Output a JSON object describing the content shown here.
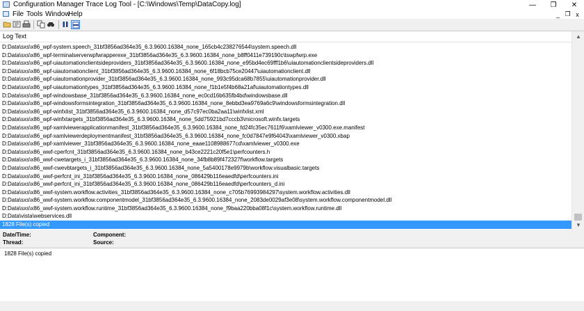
{
  "window": {
    "title": "Configuration Manager Trace Log Tool - [C:\\Windows\\Temp\\DataCopy.log]",
    "minimize_glyph": "—",
    "maximize_glyph": "❐",
    "close_glyph": "✕"
  },
  "menu": {
    "items": [
      "File",
      "Tools",
      "Window",
      "Help"
    ],
    "mdi_minimize": "_",
    "mdi_restore": "❐",
    "mdi_close": "x"
  },
  "toolbar": {
    "icons": [
      "open-icon",
      "refresh-icon",
      "print-icon",
      "copy-icon",
      "find-icon",
      "pause-icon",
      "highlight-icon"
    ]
  },
  "log": {
    "column_header": "Log Text",
    "selected_index": 22,
    "rows": [
      "D:Data\\sxs\\x86_wpf-system.speech_31bf3856ad364e35_6.3.9600.16384_none_165cb4c238276544\\system.speech.dll",
      "D:Data\\sxs\\x86_wpf-terminalserverwpfwrapperexe_31bf3856ad364e35_6.3.9600.16384_none_b8ff0411e739190c\\tswpfwrp.exe",
      "D:Data\\sxs\\x86_wpf-uiautomationclientsideproviders_31bf3856ad364e35_6.3.9600.16384_none_e95bd4ec69fff1b6\\uiautomationclientsideproviders.dll",
      "D:Data\\sxs\\x86_wpf-uiautomationclient_31bf3856ad364e35_6.3.9600.16384_none_6f18bcb75ce20447\\uiautomationclient.dll",
      "D:Data\\sxs\\x86_wpf-uiautomationprovider_31bf3856ad364e35_6.3.9600.16384_none_993c95dca68b7855\\uiautomationprovider.dll",
      "D:Data\\sxs\\x86_wpf-uiautomationtypes_31bf3856ad364e35_6.3.9600.16384_none_f1b1e5f4b68a21af\\uiautomationtypes.dll",
      "D:Data\\sxs\\x86_wpf-windowsbase_31bf3856ad364e35_6.3.9600.16384_none_ec0cd16b635fb4bd\\windowsbase.dll",
      "D:Data\\sxs\\x86_wpf-windowsformsintegration_31bf3856ad364e35_6.3.9600.16384_none_8ebbd3ea9769a6c9\\windowsformsintegration.dll",
      "D:Data\\sxs\\x86_wpf-winfxlist_31bf3856ad364e35_6.3.9600.16384_none_d57c97ec0ba2aa11\\winfxlist.xml",
      "D:Data\\sxs\\x86_wpf-winfxtargets_31bf3856ad364e35_6.3.9600.16384_none_5dd75921bd7cccb3\\microsoft.winfx.targets",
      "D:Data\\sxs\\x86_wpf-xamlviewerapplicationmanifest_31bf3856ad364e35_6.3.9600.16384_none_fd24fc35ec7611f6\\xamlviewer_v0300.exe.manifest",
      "D:Data\\sxs\\x86_wpf-xamlviewerdeploymentmanifest_31bf3856ad364e35_6.3.9600.16384_none_fc0d7847e9f64043\\xamlviewer_v0300.xbap",
      "D:Data\\sxs\\x86_wpf-xamlviewer_31bf3856ad364e35_6.3.9600.16384_none_eaae1108988677cd\\xamlviewer_v0300.exe",
      "D:Data\\sxs\\x86_wwf-cperfcnt_31bf3856ad364e35_6.3.9600.16384_none_b43ce2221c20f5e1\\perfcounters.h",
      "D:Data\\sxs\\x86_wwf-cwetargets_i_31bf3856ad364e35_6.3.9600.16384_none_34fb8b89f472327f\\workflow.targets",
      "D:Data\\sxs\\x86_wwf-cwevbtargets_i_31bf3856ad364e35_6.3.9600.16384_none_5a5400178e9979b\\workflow.visualbasic.targets",
      "D:Data\\sxs\\x86_wwf-perfcnt_ini_31bf3856ad364e35_6.3.9600.16384_none_086429b116eaedfd\\perfcounters.ini",
      "D:Data\\sxs\\x86_wwf-perfcnt_ini_31bf3856ad364e35_6.3.9600.16384_none_086429b116eaedfd\\perfcounters_d.ini",
      "D:Data\\sxs\\x86_wwf-system.workflow.activities_31bf3856ad364e35_6.3.9600.16384_none_c705b76993984297\\system.workflow.activities.dll",
      "D:Data\\sxs\\x86_wwf-system.workflow.componentmodel_31bf3856ad364e35_6.3.9600.16384_none_2083de0029af3e08\\system.workflow.componentmodel.dll",
      "D:Data\\sxs\\x86_wwf-system.workflow.runtime_31bf3856ad364e35_6.3.9600.16384_none_f9baa220bba08f1c\\system.workflow.runtime.dll",
      "D:Data\\vista\\webservices.dll",
      "1828 File(s) copied"
    ]
  },
  "details": {
    "datetime_label": "Date/Time:",
    "thread_label": "Thread:",
    "component_label": "Component:",
    "source_label": "Source:"
  },
  "message": {
    "text": "1828 File(s) copied"
  }
}
